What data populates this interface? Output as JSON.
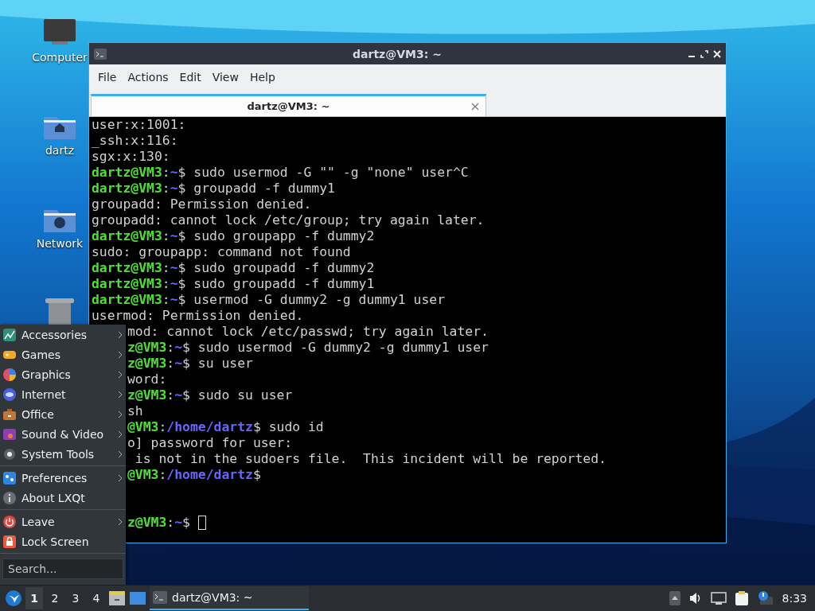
{
  "desktop_icons": [
    {
      "kind": "computer",
      "label": "Computer"
    },
    {
      "kind": "home",
      "label": "dartz"
    },
    {
      "kind": "network",
      "label": "Network"
    },
    {
      "kind": "trash"
    }
  ],
  "window": {
    "title": "dartz@VM3: ~",
    "menu": [
      "File",
      "Actions",
      "Edit",
      "View",
      "Help"
    ],
    "tabs": [
      {
        "label": "dartz@VM3: ~",
        "selected": true
      }
    ],
    "lines": [
      {
        "segments": [
          {
            "kind": "plain",
            "text": "user:x:1001:"
          }
        ]
      },
      {
        "segments": [
          {
            "kind": "plain",
            "text": "_ssh:x:116:"
          }
        ]
      },
      {
        "segments": [
          {
            "kind": "plain",
            "text": "sgx:x:130:"
          }
        ]
      },
      {
        "segments": [
          {
            "kind": "host",
            "text": "dartz@VM3"
          },
          {
            "kind": "plain",
            "text": ":"
          },
          {
            "kind": "path",
            "text": "~"
          },
          {
            "kind": "plain",
            "text": "$ sudo usermod -G \"\" -g \"none\" user^C"
          }
        ]
      },
      {
        "segments": [
          {
            "kind": "host",
            "text": "dartz@VM3"
          },
          {
            "kind": "plain",
            "text": ":"
          },
          {
            "kind": "path",
            "text": "~"
          },
          {
            "kind": "plain",
            "text": "$ groupadd -f dummy1"
          }
        ]
      },
      {
        "segments": [
          {
            "kind": "plain",
            "text": "groupadd: Permission denied."
          }
        ]
      },
      {
        "segments": [
          {
            "kind": "plain",
            "text": "groupadd: cannot lock /etc/group; try again later."
          }
        ]
      },
      {
        "segments": [
          {
            "kind": "host",
            "text": "dartz@VM3"
          },
          {
            "kind": "plain",
            "text": ":"
          },
          {
            "kind": "path",
            "text": "~"
          },
          {
            "kind": "plain",
            "text": "$ sudo groupapp -f dummy2"
          }
        ]
      },
      {
        "segments": [
          {
            "kind": "plain",
            "text": "sudo: groupapp: command not found"
          }
        ]
      },
      {
        "segments": [
          {
            "kind": "host",
            "text": "dartz@VM3"
          },
          {
            "kind": "plain",
            "text": ":"
          },
          {
            "kind": "path",
            "text": "~"
          },
          {
            "kind": "plain",
            "text": "$ sudo groupadd -f dummy2"
          }
        ]
      },
      {
        "segments": [
          {
            "kind": "host",
            "text": "dartz@VM3"
          },
          {
            "kind": "plain",
            "text": ":"
          },
          {
            "kind": "path",
            "text": "~"
          },
          {
            "kind": "plain",
            "text": "$ sudo groupadd -f dummy1"
          }
        ]
      },
      {
        "segments": [
          {
            "kind": "host",
            "text": "dartz@VM3"
          },
          {
            "kind": "plain",
            "text": ":"
          },
          {
            "kind": "path",
            "text": "~"
          },
          {
            "kind": "plain",
            "text": "$ usermod -G dummy2 -g dummy1 user"
          }
        ]
      },
      {
        "segments": [
          {
            "kind": "plain",
            "text": "usermod: Permission denied."
          }
        ]
      },
      {
        "clipped": true,
        "segments": [
          {
            "kind": "plain",
            "text": "mod: cannot lock /etc/passwd; try again later."
          }
        ]
      },
      {
        "clipped": true,
        "segments": [
          {
            "kind": "host",
            "text": "z@VM3"
          },
          {
            "kind": "plain",
            "text": ":"
          },
          {
            "kind": "path",
            "text": "~"
          },
          {
            "kind": "plain",
            "text": "$ sudo usermod -G dummy2 -g dummy1 user"
          }
        ]
      },
      {
        "clipped": true,
        "segments": [
          {
            "kind": "host",
            "text": "z@VM3"
          },
          {
            "kind": "plain",
            "text": ":"
          },
          {
            "kind": "path",
            "text": "~"
          },
          {
            "kind": "plain",
            "text": "$ su user"
          }
        ]
      },
      {
        "clipped": true,
        "segments": [
          {
            "kind": "plain",
            "text": "word:"
          }
        ]
      },
      {
        "clipped": true,
        "segments": [
          {
            "kind": "host",
            "text": "z@VM3"
          },
          {
            "kind": "plain",
            "text": ":"
          },
          {
            "kind": "path",
            "text": "~"
          },
          {
            "kind": "plain",
            "text": "$ sudo su user"
          }
        ]
      },
      {
        "clipped": true,
        "segments": [
          {
            "kind": "plain",
            "text": "sh"
          }
        ]
      },
      {
        "clipped": true,
        "segments": [
          {
            "kind": "host",
            "text": "@VM3"
          },
          {
            "kind": "plain",
            "text": ":"
          },
          {
            "kind": "path",
            "text": "/home/dartz"
          },
          {
            "kind": "plain",
            "text": "$ sudo id"
          }
        ]
      },
      {
        "clipped": true,
        "segments": [
          {
            "kind": "plain",
            "text": "o] password for user:"
          }
        ]
      },
      {
        "clipped": true,
        "segments": [
          {
            "kind": "plain",
            "text": " is not in the sudoers file.  This incident will be reported."
          }
        ]
      },
      {
        "clipped": true,
        "segments": [
          {
            "kind": "host",
            "text": "@VM3"
          },
          {
            "kind": "plain",
            "text": ":"
          },
          {
            "kind": "path",
            "text": "/home/dartz"
          },
          {
            "kind": "plain",
            "text": "$"
          }
        ]
      },
      {
        "kind": "blank"
      },
      {
        "kind": "blank"
      },
      {
        "clipped": true,
        "cursor": true,
        "segments": [
          {
            "kind": "host",
            "text": "z@VM3"
          },
          {
            "kind": "plain",
            "text": ":"
          },
          {
            "kind": "path",
            "text": "~"
          },
          {
            "kind": "plain",
            "text": "$ "
          }
        ]
      }
    ]
  },
  "app_menu": {
    "sections": [
      [
        {
          "label": "Accessories",
          "kind": "accessories",
          "submenu": true
        },
        {
          "label": "Games",
          "kind": "games",
          "submenu": true
        },
        {
          "label": "Graphics",
          "kind": "graphics",
          "submenu": true
        },
        {
          "label": "Internet",
          "kind": "internet",
          "submenu": true
        },
        {
          "label": "Office",
          "kind": "office",
          "submenu": true
        },
        {
          "label": "Sound & Video",
          "kind": "media",
          "submenu": true
        },
        {
          "label": "System Tools",
          "kind": "system",
          "submenu": true
        }
      ],
      [
        {
          "label": "Preferences",
          "kind": "preferences",
          "submenu": true
        },
        {
          "label": "About LXQt",
          "kind": "about",
          "submenu": false
        }
      ],
      [
        {
          "label": "Leave",
          "kind": "leave",
          "submenu": true
        },
        {
          "label": "Lock Screen",
          "kind": "lock",
          "submenu": false
        }
      ]
    ],
    "search": {
      "placeholder": "Search..."
    }
  },
  "taskbar": {
    "desktops": [
      {
        "label": "1",
        "selected": true
      },
      {
        "label": "2",
        "selected": false
      },
      {
        "label": "3",
        "selected": false
      },
      {
        "label": "4",
        "selected": false
      }
    ],
    "tasks": [
      {
        "label": "dartz@VM3: ~",
        "selected": true
      }
    ],
    "clock": "8:33"
  }
}
